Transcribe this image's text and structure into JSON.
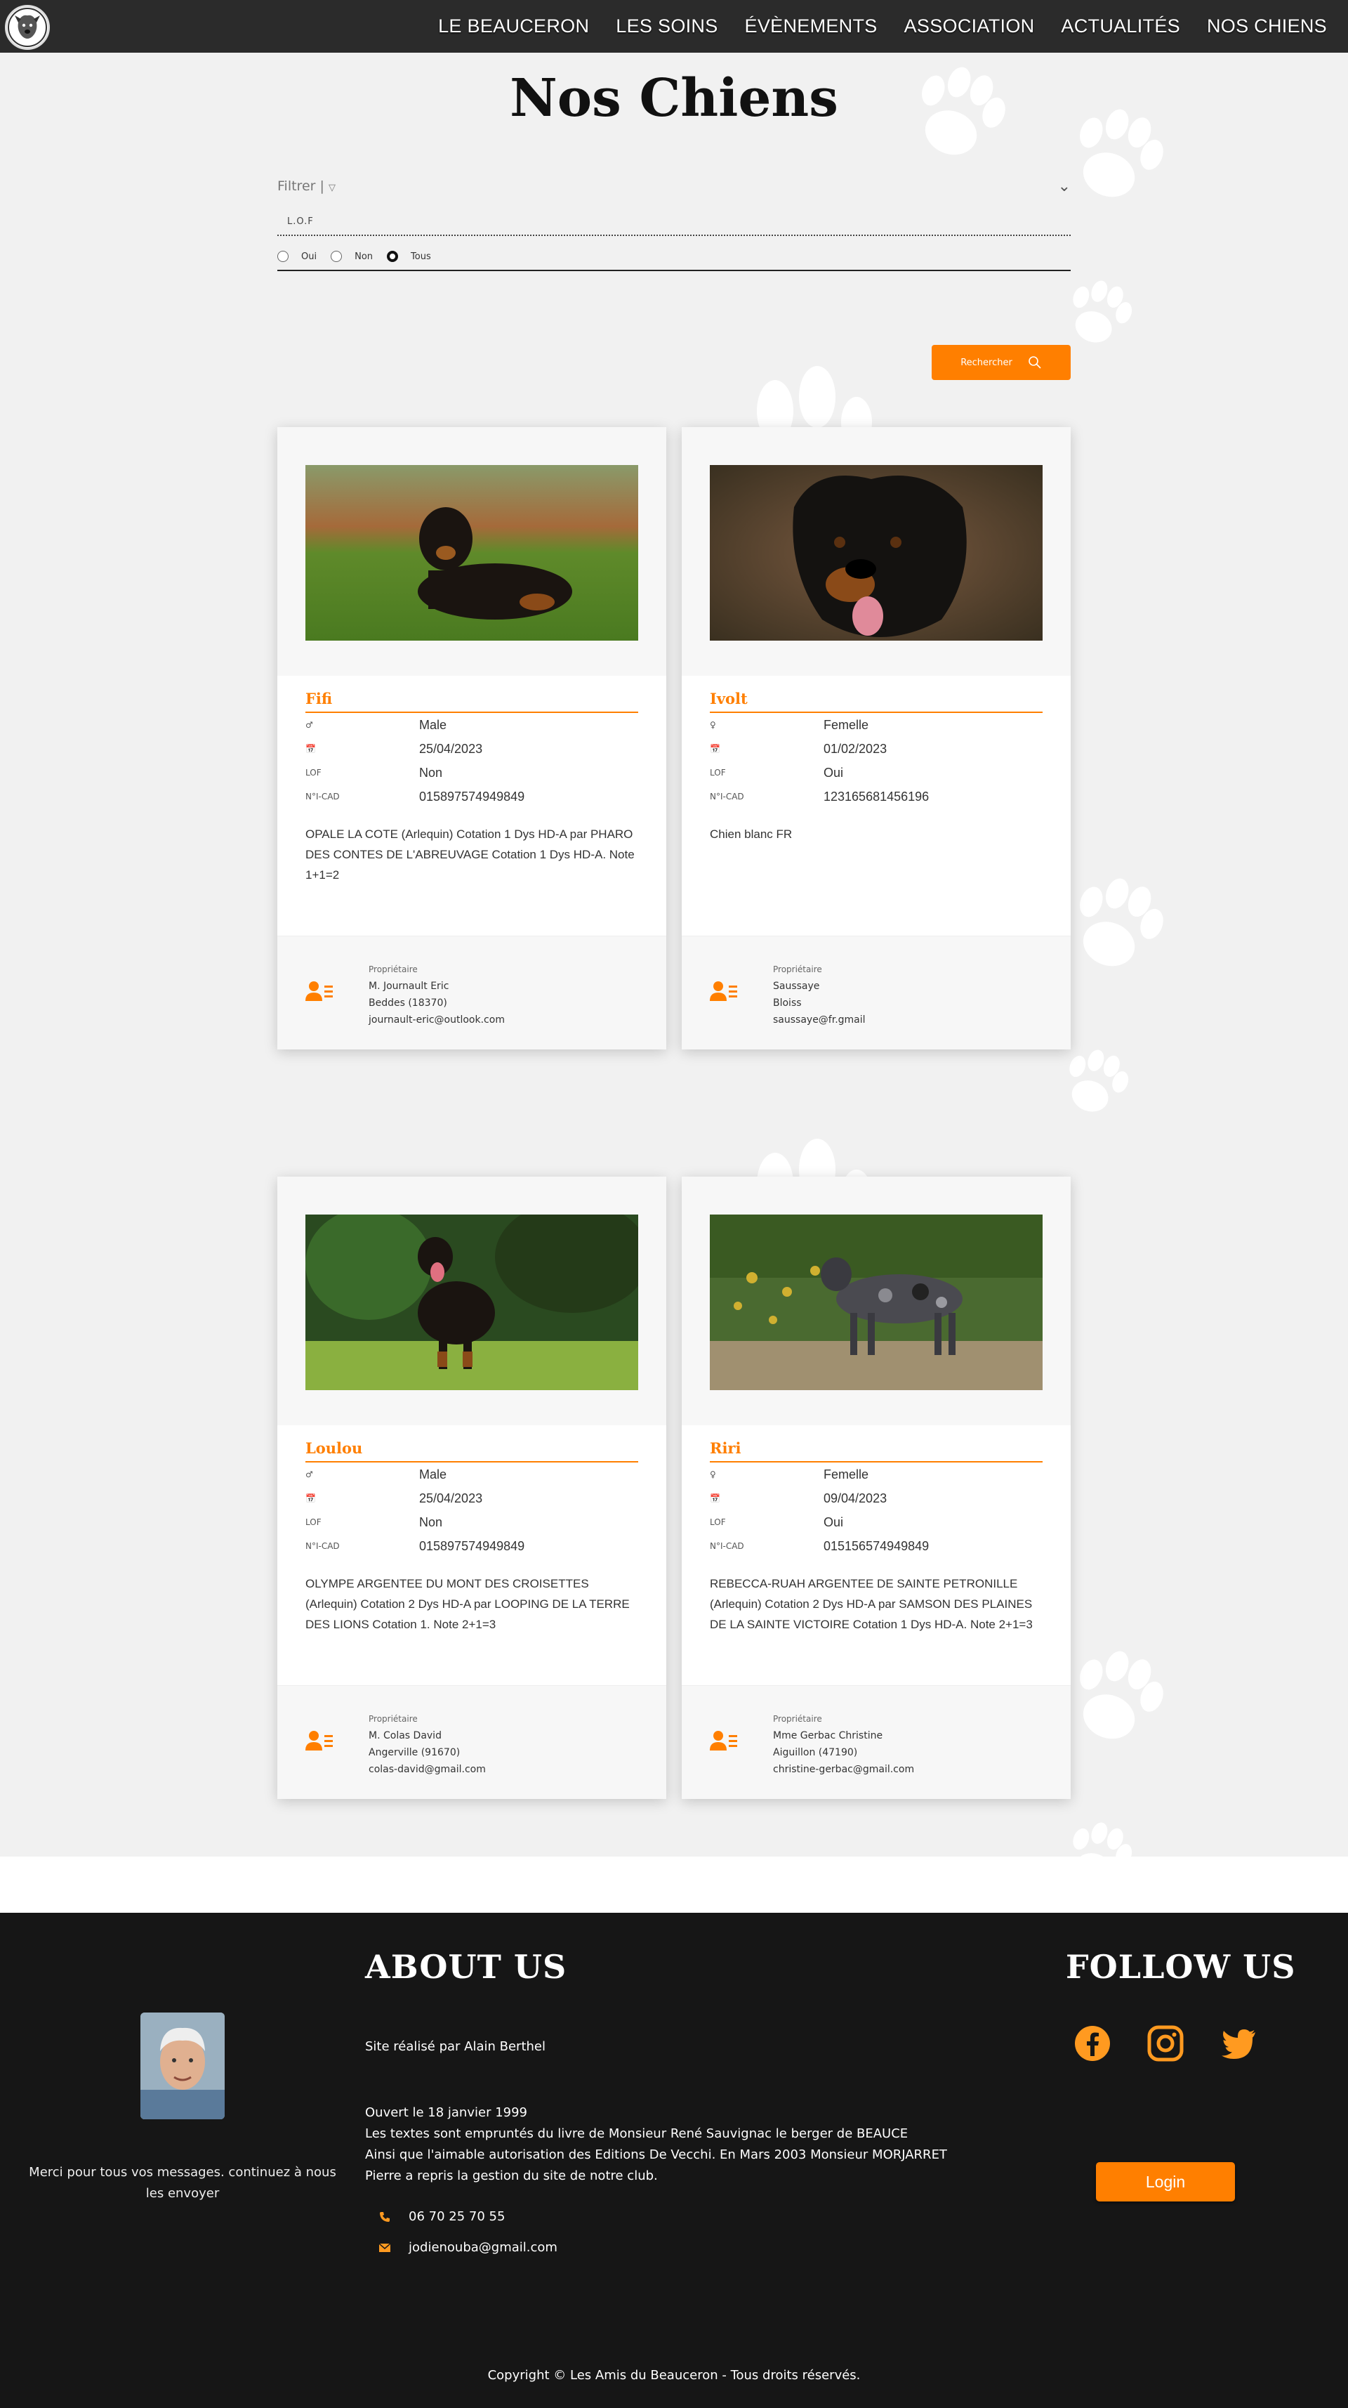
{
  "nav": {
    "items": [
      "LE BEAUCERON",
      "LES SOINS",
      "ÉVÈNEMENTS",
      "ASSOCIATION",
      "ACTUALITÉS",
      "NOS CHIENS"
    ]
  },
  "page": {
    "title": "Nos Chiens"
  },
  "filter": {
    "label": "Filtrer |",
    "lof_label": "L.O.F",
    "options": [
      "Oui",
      "Non",
      "Tous"
    ],
    "selected": "Tous",
    "search_label": "Rechercher"
  },
  "labels": {
    "lof": "LOF",
    "cad": "N°I-CAD",
    "owner": "Propriétaire"
  },
  "dogs": [
    {
      "name": "Fifi",
      "sex_icon": "male-icon",
      "sex": "Male",
      "birth": "25/04/2023",
      "lof": "Non",
      "icad": "015897574949849",
      "description": "OPALE LA COTE (Arlequin) Cotation 1 Dys HD-A par PHARO DES CONTES DE L'ABREUVAGE Cotation 1 Dys HD-A. Note 1+1=2",
      "owner": {
        "name": "M. Journault Eric",
        "city": "Beddes (18370)",
        "email": "journault-eric@outlook.com"
      }
    },
    {
      "name": "Ivolt",
      "sex_icon": "female-icon",
      "sex": "Femelle",
      "birth": "01/02/2023",
      "lof": "Oui",
      "icad": "123165681456196",
      "description": "Chien blanc FR",
      "owner": {
        "name": "Saussaye",
        "city": "Bloiss",
        "email": "saussaye@fr.gmail"
      }
    },
    {
      "name": "Loulou",
      "sex_icon": "male-icon",
      "sex": "Male",
      "birth": "25/04/2023",
      "lof": "Non",
      "icad": "015897574949849",
      "description": "OLYMPE ARGENTEE DU MONT DES CROISETTES (Arlequin) Cotation 2 Dys HD-A par LOOPING DE LA TERRE DES LIONS Cotation 1. Note 2+1=3",
      "owner": {
        "name": "M. Colas David",
        "city": "Angerville (91670)",
        "email": "colas-david@gmail.com"
      }
    },
    {
      "name": "Riri",
      "sex_icon": "female-icon",
      "sex": "Femelle",
      "birth": "09/04/2023",
      "lof": "Oui",
      "icad": "015156574949849",
      "description": "REBECCA-RUAH ARGENTEE DE SAINTE PETRONILLE (Arlequin) Cotation 2 Dys HD-A par SAMSON DES PLAINES DE LA SAINTE VICTOIRE Cotation 1 Dys HD-A. Note 2+1=3",
      "owner": {
        "name": "Mme Gerbac Christine",
        "city": "Aiguillon (47190)",
        "email": "christine-gerbac@gmail.com"
      }
    }
  ],
  "footer": {
    "thanks": "Merci pour tous vos messages. continuez à nous les envoyer",
    "about_title": "ABOUT US",
    "realise": "Site réalisé par Alain Berthel",
    "about_lines": [
      "Ouvert le 18 janvier 1999",
      "Les textes sont empruntés du livre de Monsieur René Sauvignac le berger de BEAUCE",
      "Ainsi que l'aimable autorisation des Editions De Vecchi. En Mars 2003 Monsieur MORJARRET",
      "Pierre a repris la gestion du site de notre club."
    ],
    "phone": "06 70 25 70 55",
    "email": "jodienouba@gmail.com",
    "follow_title": "FOLLOW US",
    "socials": [
      "facebook-icon",
      "instagram-icon",
      "twitter-icon"
    ],
    "login_label": "Login",
    "copyright": "Copyright © Les Amis du Beauceron - Tous droits réservés."
  },
  "colors": {
    "accent": "#ff7f00",
    "nav_bg": "#2b2b2b",
    "footer_bg": "#161616"
  }
}
